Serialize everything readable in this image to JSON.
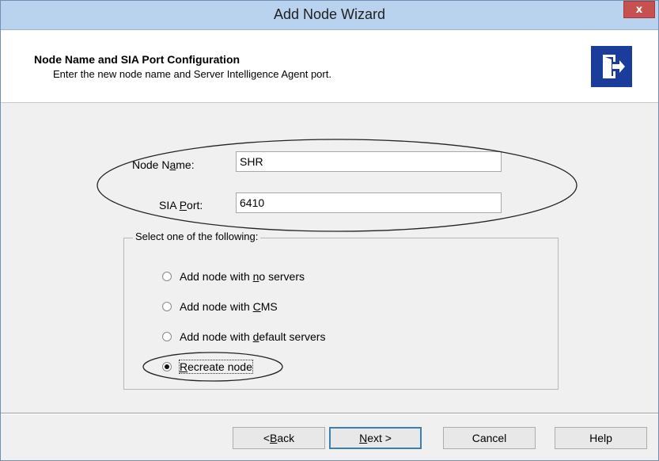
{
  "window": {
    "title": "Add Node Wizard",
    "close_label": "x"
  },
  "header": {
    "title": "Node Name and SIA Port Configuration",
    "subtitle": "Enter the new node name and Server Intelligence Agent port.",
    "icon": "exit-door-arrow-icon"
  },
  "form": {
    "node_name": {
      "label": "Node Name:",
      "mnemonic_index": 6,
      "value": "SHR"
    },
    "sia_port": {
      "label": "SIA Port:",
      "mnemonic_index": 4,
      "value": "6410"
    }
  },
  "options": {
    "legend": "Select one of the following:",
    "items": [
      {
        "pre": "Add node with ",
        "mnem": "n",
        "post": "o servers",
        "selected": false
      },
      {
        "pre": "Add node with ",
        "mnem": "C",
        "post": "MS",
        "selected": false
      },
      {
        "pre": "Add node with ",
        "mnem": "d",
        "post": "efault servers",
        "selected": false
      },
      {
        "pre": "",
        "mnem": "R",
        "post": "ecreate node",
        "selected": true
      }
    ]
  },
  "buttons": {
    "back": {
      "pre": "< ",
      "mnem": "B",
      "post": "ack"
    },
    "next": {
      "pre": "",
      "mnem": "N",
      "post": "ext >"
    },
    "cancel": {
      "label": "Cancel"
    },
    "help": {
      "label": "Help"
    }
  },
  "colors": {
    "titlebar": "#b9d3ee",
    "close_button": "#c75050",
    "header_icon_bg": "#1a3d9c",
    "annotation_stroke": "#222222"
  }
}
